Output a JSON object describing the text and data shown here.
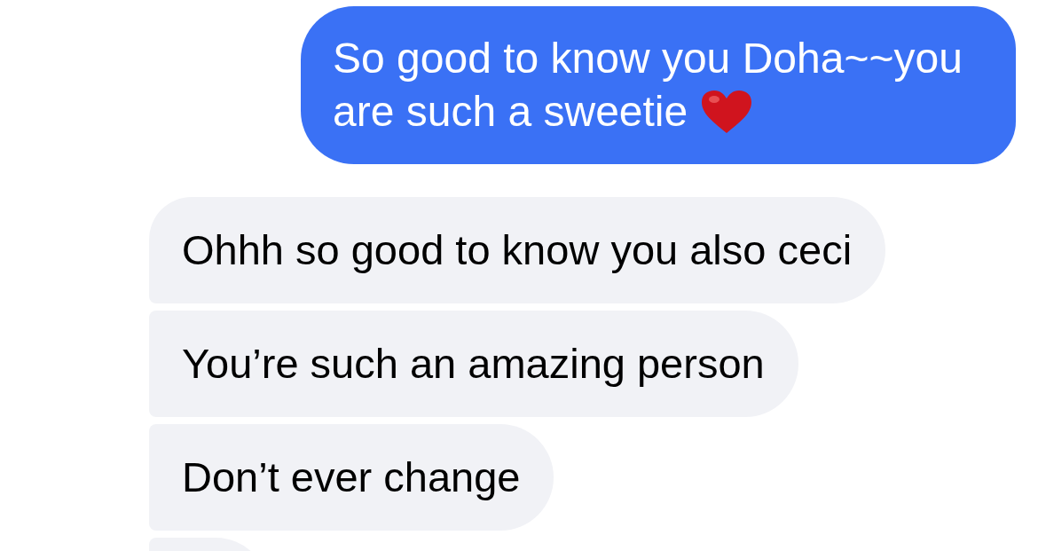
{
  "messages": [
    {
      "kind": "sent",
      "text": "So good to know you Doha~~you are such a sweetie",
      "emoji": true
    },
    {
      "kind": "received",
      "text": "Ohhh so good to know you also ceci"
    },
    {
      "kind": "received",
      "text": "You’re such an amazing person"
    },
    {
      "kind": "received",
      "text": "Don’t ever change"
    },
    {
      "kind": "received"
    }
  ]
}
